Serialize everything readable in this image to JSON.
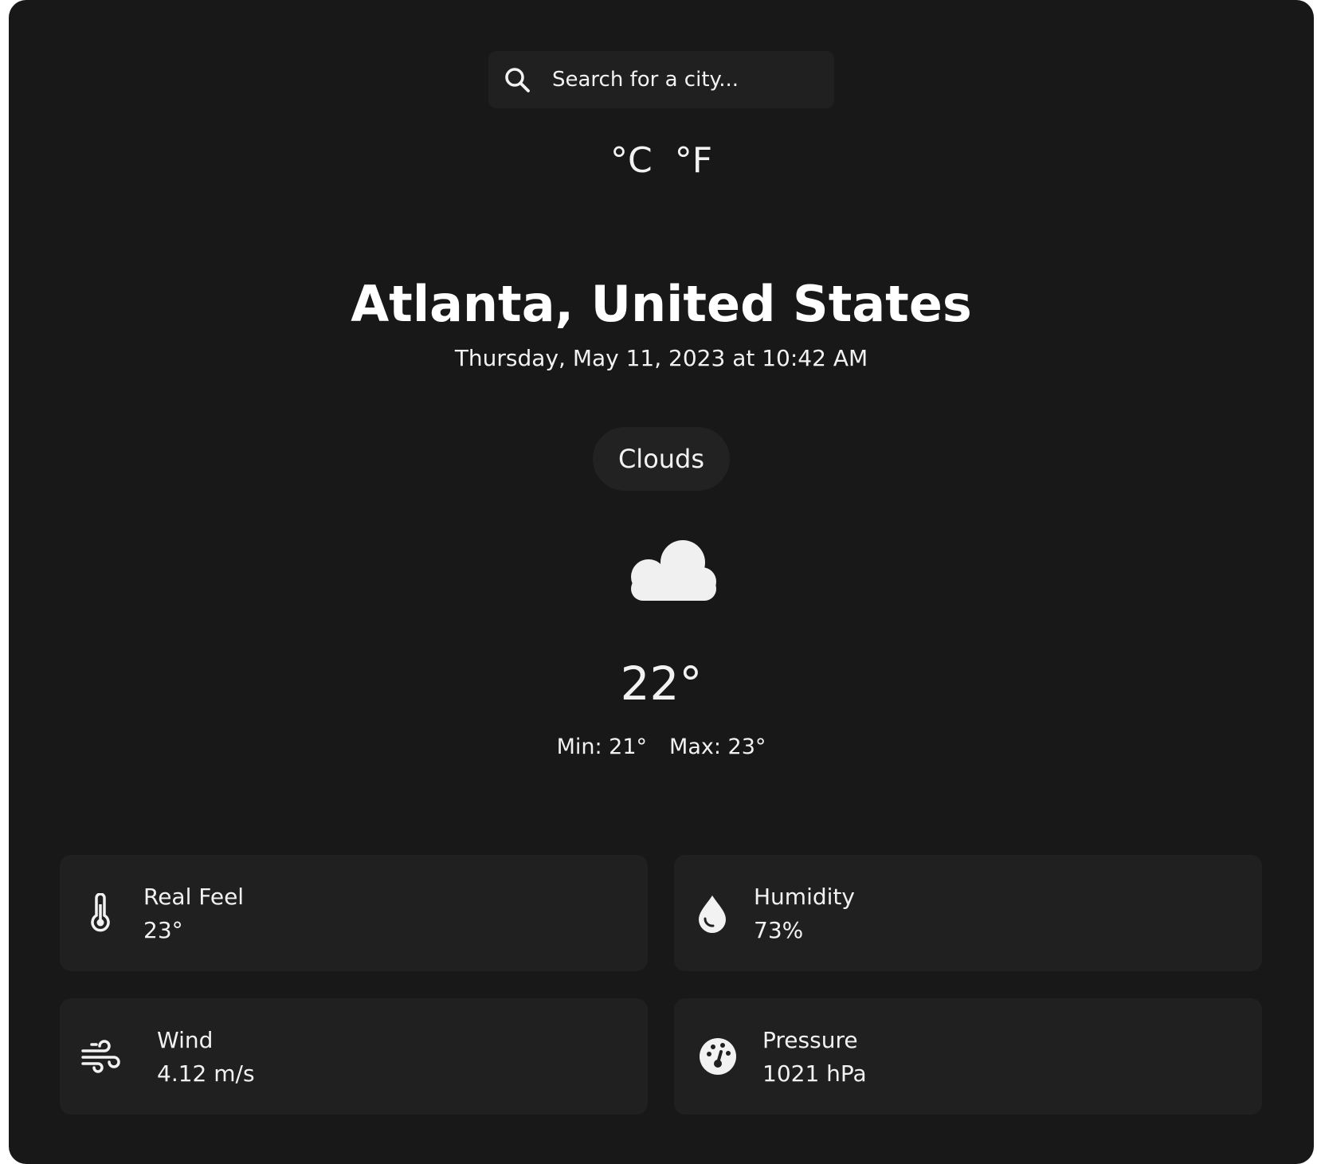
{
  "search": {
    "placeholder": "Search for a city..."
  },
  "units": {
    "celsius": "°C",
    "fahrenheit": "°F"
  },
  "location": {
    "city": "Atlanta, United States",
    "datetime": "Thursday, May 11, 2023 at 10:42 AM"
  },
  "weather": {
    "condition": "Clouds",
    "icon": "cloud-icon",
    "temperature": "22°",
    "min": "Min: 21°",
    "max": "Max: 23°"
  },
  "details": {
    "real_feel": {
      "label": "Real Feel",
      "value": "23°",
      "icon": "thermometer-icon"
    },
    "humidity": {
      "label": "Humidity",
      "value": "73%",
      "icon": "droplet-icon"
    },
    "wind": {
      "label": "Wind",
      "value": "4.12 m/s",
      "icon": "wind-icon"
    },
    "pressure": {
      "label": "Pressure",
      "value": "1021 hPa",
      "icon": "gauge-icon"
    }
  },
  "colors": {
    "background": "#181818",
    "card": "#202020",
    "text": "#f2f2f2"
  }
}
